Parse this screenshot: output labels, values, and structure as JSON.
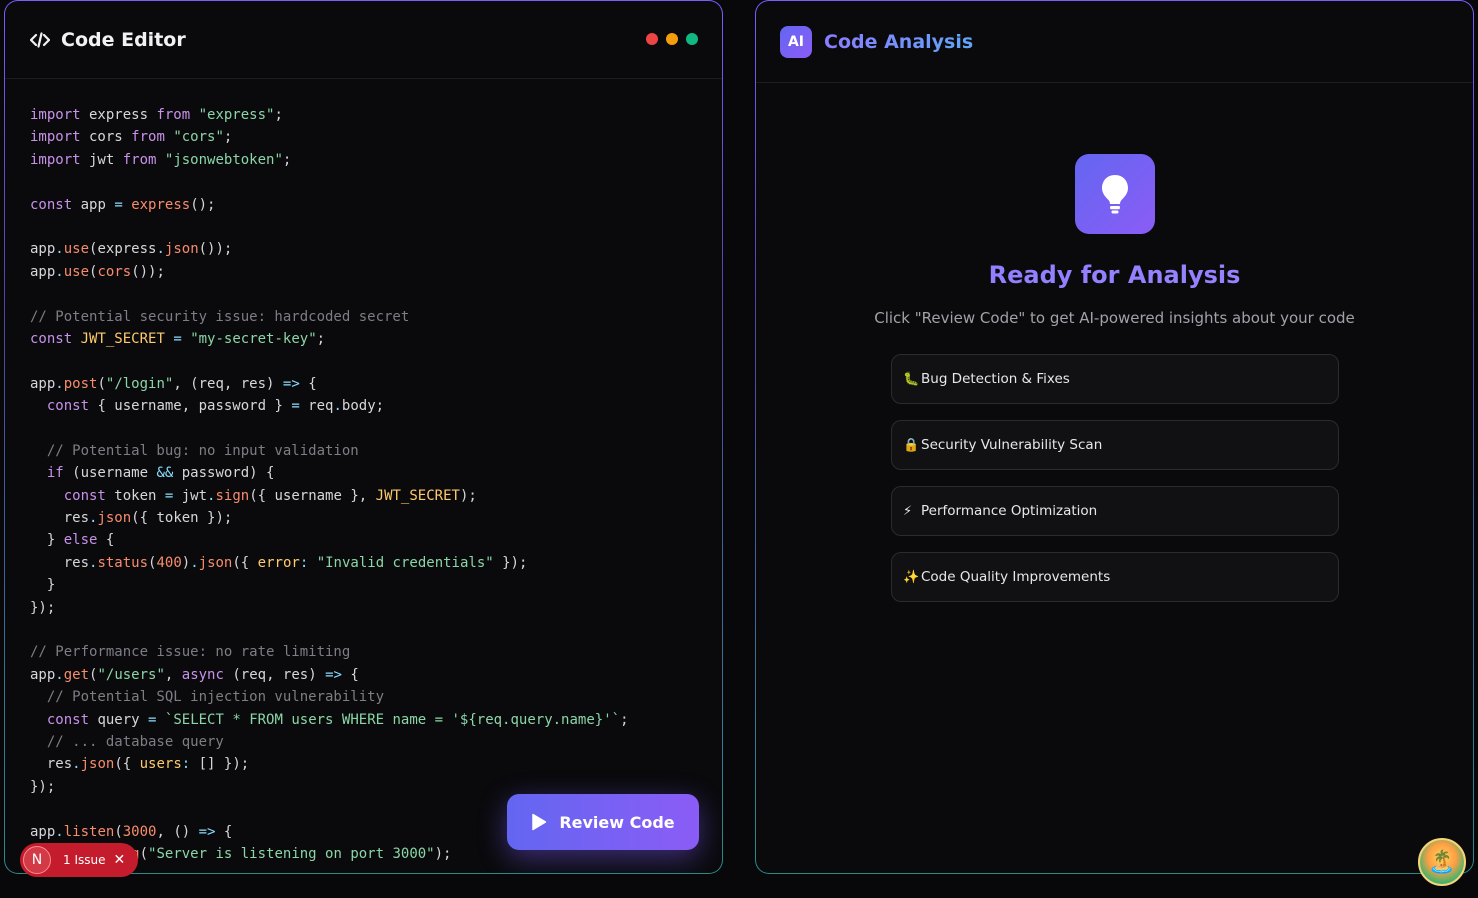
{
  "editor": {
    "title": "Code Editor",
    "review_button": "Review Code",
    "issue_badge": {
      "letter": "N",
      "count_label": "1 Issue"
    },
    "code_lines": [
      "import express from \"express\";",
      "import cors from \"cors\";",
      "import jwt from \"jsonwebtoken\";",
      "",
      "const app = express();",
      "",
      "app.use(express.json());",
      "app.use(cors());",
      "",
      "// Potential security issue: hardcoded secret",
      "const JWT_SECRET = \"my-secret-key\";",
      "",
      "app.post(\"/login\", (req, res) => {",
      "  const { username, password } = req.body;",
      "",
      "  // Potential bug: no input validation",
      "  if (username && password) {",
      "    const token = jwt.sign({ username }, JWT_SECRET);",
      "    res.json({ token });",
      "  } else {",
      "    res.status(400).json({ error: \"Invalid credentials\" });",
      "  }",
      "});",
      "",
      "// Performance issue: no rate limiting",
      "app.get(\"/users\", async (req, res) => {",
      "  // Potential SQL injection vulnerability",
      "  const query = `SELECT * FROM users WHERE name = '${req.query.name}'`;",
      "  // ... database query",
      "  res.json({ users: [] });",
      "});",
      "",
      "app.listen(3000, () => {",
      "  console.log(\"Server is listening on port 3000\");"
    ]
  },
  "analysis": {
    "badge": "AI",
    "title": "Code Analysis",
    "ready_title": "Ready for Analysis",
    "ready_subtitle": "Click \"Review Code\" to get AI-powered insights about your code",
    "features": [
      {
        "icon": "bug-icon",
        "glyph": "🐛",
        "label": "Bug Detection & Fixes"
      },
      {
        "icon": "lock-icon",
        "glyph": "🔒",
        "label": "Security Vulnerability Scan"
      },
      {
        "icon": "lightning-icon",
        "glyph": "⚡",
        "label": "Performance Optimization"
      },
      {
        "icon": "sparkles-icon",
        "glyph": "✨",
        "label": "Code Quality Improvements"
      }
    ]
  },
  "colors": {
    "accent_start": "#6366f1",
    "accent_end": "#8b5cf6",
    "issue_red": "#c41c2c"
  }
}
